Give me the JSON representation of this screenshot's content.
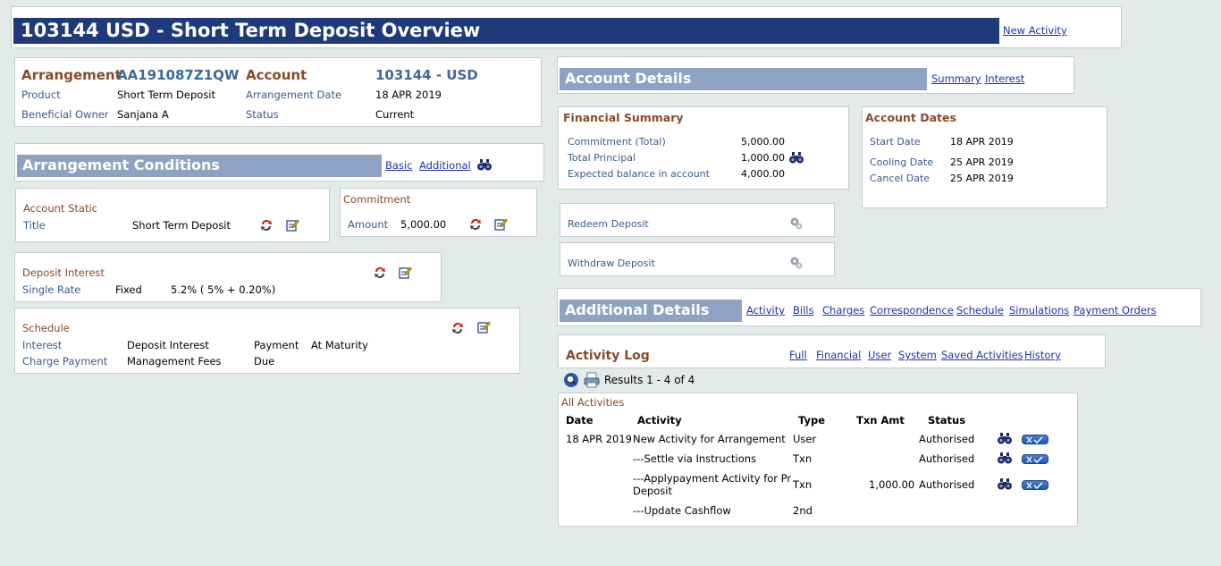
{
  "header": {
    "title": "103144 USD - Short Term Deposit Overview",
    "new_activity": "New Activity"
  },
  "arrangement": {
    "arrangement_label": "Arrangement",
    "arrangement_value": "AA191087Z1QW",
    "account_label": "Account",
    "account_value": "103144 - USD",
    "product_label": "Product",
    "product_value": "Short Term Deposit",
    "arrangement_date_label": "Arrangement Date",
    "arrangement_date_value": "18 APR 2019",
    "beneficial_owner_label": "Beneficial Owner",
    "beneficial_owner_value": "Sanjana A",
    "status_label": "Status",
    "status_value": "Current"
  },
  "conditions": {
    "title": "Arrangement Conditions",
    "basic": "Basic",
    "additional": "Additional",
    "account_static": {
      "heading": "Account Static",
      "title_label": "Title",
      "title_value": "Short Term Deposit"
    },
    "commitment": {
      "heading": "Commitment",
      "amount_label": "Amount",
      "amount_value": "5,000.00"
    },
    "deposit_interest": {
      "heading": "Deposit Interest",
      "rate_label": "Single Rate",
      "rate_type": "Fixed",
      "rate_value": "5.2% ( 5% + 0.20%)"
    },
    "schedule": {
      "heading": "Schedule",
      "interest_label": "Interest",
      "interest_value": "Deposit Interest",
      "payment_label": "Payment",
      "payment_value": "At Maturity",
      "charge_label": "Charge Payment",
      "charge_value": "Management Fees",
      "due_label": "Due"
    }
  },
  "account_details": {
    "title": "Account Details",
    "summary": "Summary",
    "interest": "Interest",
    "financial_summary": {
      "heading": "Financial Summary",
      "commitment_label": "Commitment (Total)",
      "commitment_value": "5,000.00",
      "principal_label": "Total Principal",
      "principal_value": "1,000.00",
      "expected_label": "Expected balance in account",
      "expected_value": "4,000.00"
    },
    "account_dates": {
      "heading": "Account Dates",
      "start_label": "Start Date",
      "start_value": "18 APR 2019",
      "cooling_label": "Cooling Date",
      "cooling_value": "25 APR 2019",
      "cancel_label": "Cancel Date",
      "cancel_value": "25 APR 2019"
    },
    "redeem": "Redeem Deposit",
    "withdraw": "Withdraw Deposit"
  },
  "additional_details": {
    "title": "Additional Details",
    "links": [
      "Activity",
      "Bills",
      "Charges",
      "Correspondence",
      "Schedule",
      "Simulations",
      "Payment Orders"
    ]
  },
  "activity_log": {
    "title": "Activity Log",
    "links": [
      "Full",
      "Financial",
      "User",
      "System",
      "Saved Activities",
      "History"
    ],
    "results": "Results 1 - 4 of 4",
    "section": "All Activities",
    "columns": [
      "Date",
      "Activity",
      "Type",
      "Txn Amt",
      "Status"
    ],
    "rows": [
      {
        "date": "18 APR 2019",
        "activity": "New Activity for Arrangement",
        "type": "User",
        "amount": "",
        "status": "Authorised"
      },
      {
        "date": "",
        "activity": "---Settle via Instructions",
        "type": "Txn",
        "amount": "",
        "status": "Authorised"
      },
      {
        "date": "",
        "activity": "---Applypayment Activity for Pr",
        "activity2": "Deposit",
        "type": "Txn",
        "amount": "1,000.00",
        "status": "Authorised"
      },
      {
        "date": "",
        "activity": "---Update Cashflow",
        "type": "2nd",
        "amount": "",
        "status": ""
      }
    ]
  }
}
